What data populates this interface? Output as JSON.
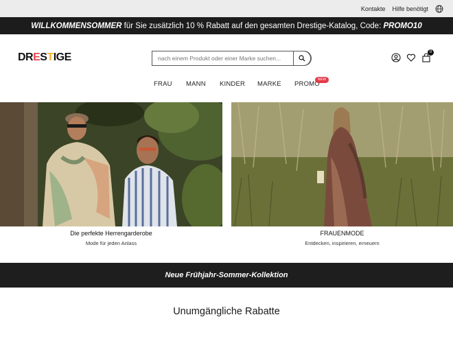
{
  "topbar": {
    "contact": "Kontakte",
    "help": "Hilfe benötigt",
    "language_icon": "globe-icon"
  },
  "promo": {
    "code_name": "WILLKOMMENSOMMER",
    "text": " für Sie zusätzlich 10 % Rabatt auf den gesamten Drestige-Katalog, Code: ",
    "code": "PROMO10"
  },
  "header": {
    "logo": {
      "pre": "DR",
      "e1": "E",
      "mid": "S",
      "e2": "T",
      "post": "IGE"
    },
    "search": {
      "placeholder": "nach einem Produkt oder einer Marke suchen..."
    },
    "icons": [
      "user-icon",
      "heart-icon",
      "cart-icon"
    ],
    "cart_count": "0"
  },
  "nav": {
    "items": [
      {
        "label": "FRAU"
      },
      {
        "label": "MANN"
      },
      {
        "label": "KINDER"
      },
      {
        "label": "MARKE"
      },
      {
        "label": "PROMO"
      }
    ],
    "promo_badge": "NEW"
  },
  "heroes": [
    {
      "title": "Die perfekte Herrengarderobe",
      "subtitle": "Mode für jeden Anlass"
    },
    {
      "title": "FRAUENMODE",
      "subtitle": "Entdecken, inspirieren, erneuern"
    }
  ],
  "banner": {
    "label": "Neue Frühjahr-Sommer-Kollektion"
  },
  "section": {
    "title": "Unumgängliche Rabatte"
  },
  "colors": {
    "dark": "#1c1c1c",
    "accent": "#e33a49",
    "logo_e": "#e8454d",
    "logo_t": "#f2b230"
  }
}
